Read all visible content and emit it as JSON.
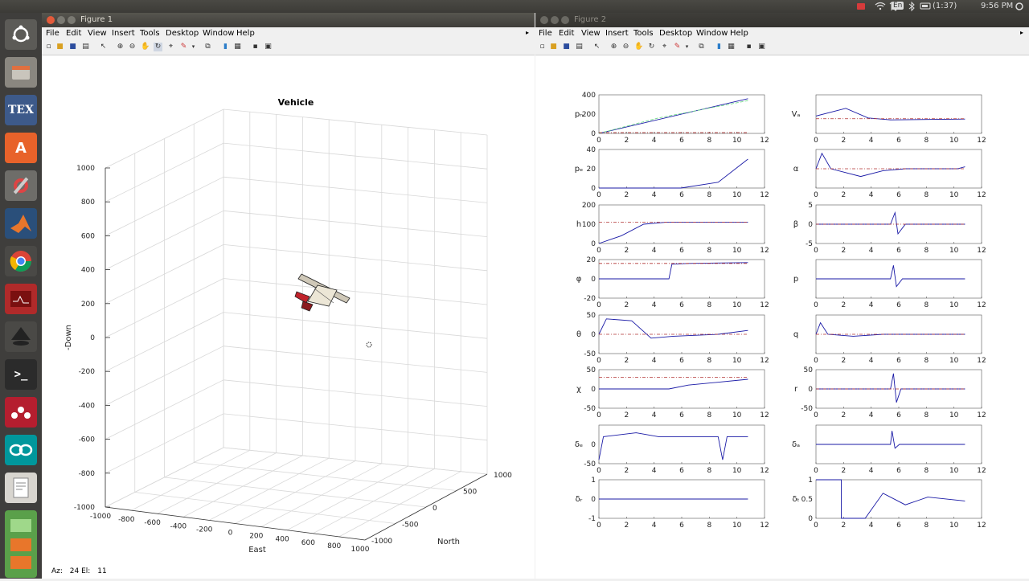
{
  "system": {
    "keyboard": "En",
    "battery": "(1:37)",
    "clock": "9:56 PM"
  },
  "menus": [
    "File",
    "Edit",
    "View",
    "Insert",
    "Tools",
    "Desktop",
    "Window",
    "Help"
  ],
  "figure1": {
    "window_title": "Figure 1",
    "plot_title": "Vehicle",
    "z_label": "-Down",
    "x_label": "East",
    "y_label": "North",
    "z_ticks": [
      "1000",
      "800",
      "600",
      "400",
      "200",
      "0",
      "-200",
      "-400",
      "-600",
      "-800",
      "-1000"
    ],
    "x_ticks": [
      "-1000",
      "-800",
      "-600",
      "-400",
      "-200",
      "0",
      "200",
      "400",
      "600",
      "800",
      "1000"
    ],
    "y_ticks": [
      "-1000",
      "-500",
      "0",
      "500",
      "1000"
    ],
    "view": {
      "az_label": "Az:",
      "az": "24",
      "el_label": "El:",
      "el": "11"
    }
  },
  "figure2": {
    "window_title": "Figure 2",
    "x_ticks": [
      "0",
      "2",
      "4",
      "6",
      "8",
      "10",
      "12"
    ],
    "panels": [
      {
        "id": "pn",
        "label": "pₙ",
        "yticks": [
          "400",
          "200",
          "0"
        ]
      },
      {
        "id": "Va",
        "label": "Vₐ",
        "yticks": [
          "",
          "",
          ""
        ]
      },
      {
        "id": "pe",
        "label": "pₑ",
        "yticks": [
          "40",
          "20",
          "0"
        ]
      },
      {
        "id": "alpha",
        "label": "α",
        "yticks": [
          "",
          "",
          ""
        ]
      },
      {
        "id": "h",
        "label": "h",
        "yticks": [
          "200",
          "100",
          "0"
        ]
      },
      {
        "id": "beta",
        "label": "β",
        "yticks": [
          "5",
          "0",
          "-5"
        ]
      },
      {
        "id": "phi",
        "label": "φ",
        "yticks": [
          "20",
          "0",
          "-20"
        ]
      },
      {
        "id": "p",
        "label": "p",
        "yticks": [
          "",
          "",
          ""
        ]
      },
      {
        "id": "theta",
        "label": "θ",
        "yticks": [
          "50",
          "0",
          "-50"
        ]
      },
      {
        "id": "q",
        "label": "q",
        "yticks": [
          "",
          "",
          ""
        ]
      },
      {
        "id": "chi",
        "label": "χ",
        "yticks": [
          "50",
          "0",
          "-50"
        ]
      },
      {
        "id": "r",
        "label": "r",
        "yticks": [
          "50",
          "0",
          "-50"
        ]
      },
      {
        "id": "delta_e",
        "label": "δₑ",
        "yticks": [
          "",
          "0",
          "-50"
        ]
      },
      {
        "id": "delta_a",
        "label": "δₐ",
        "yticks": [
          "",
          "",
          ""
        ]
      },
      {
        "id": "delta_r",
        "label": "δᵣ",
        "yticks": [
          "1",
          "0",
          "-1"
        ]
      },
      {
        "id": "delta_t",
        "label": "δₜ",
        "yticks": [
          "1",
          "0.5",
          "0"
        ]
      }
    ]
  },
  "colors": {
    "actual": "#1a1aa6",
    "estimate": "#6fd98a",
    "command": "#b03030"
  }
}
